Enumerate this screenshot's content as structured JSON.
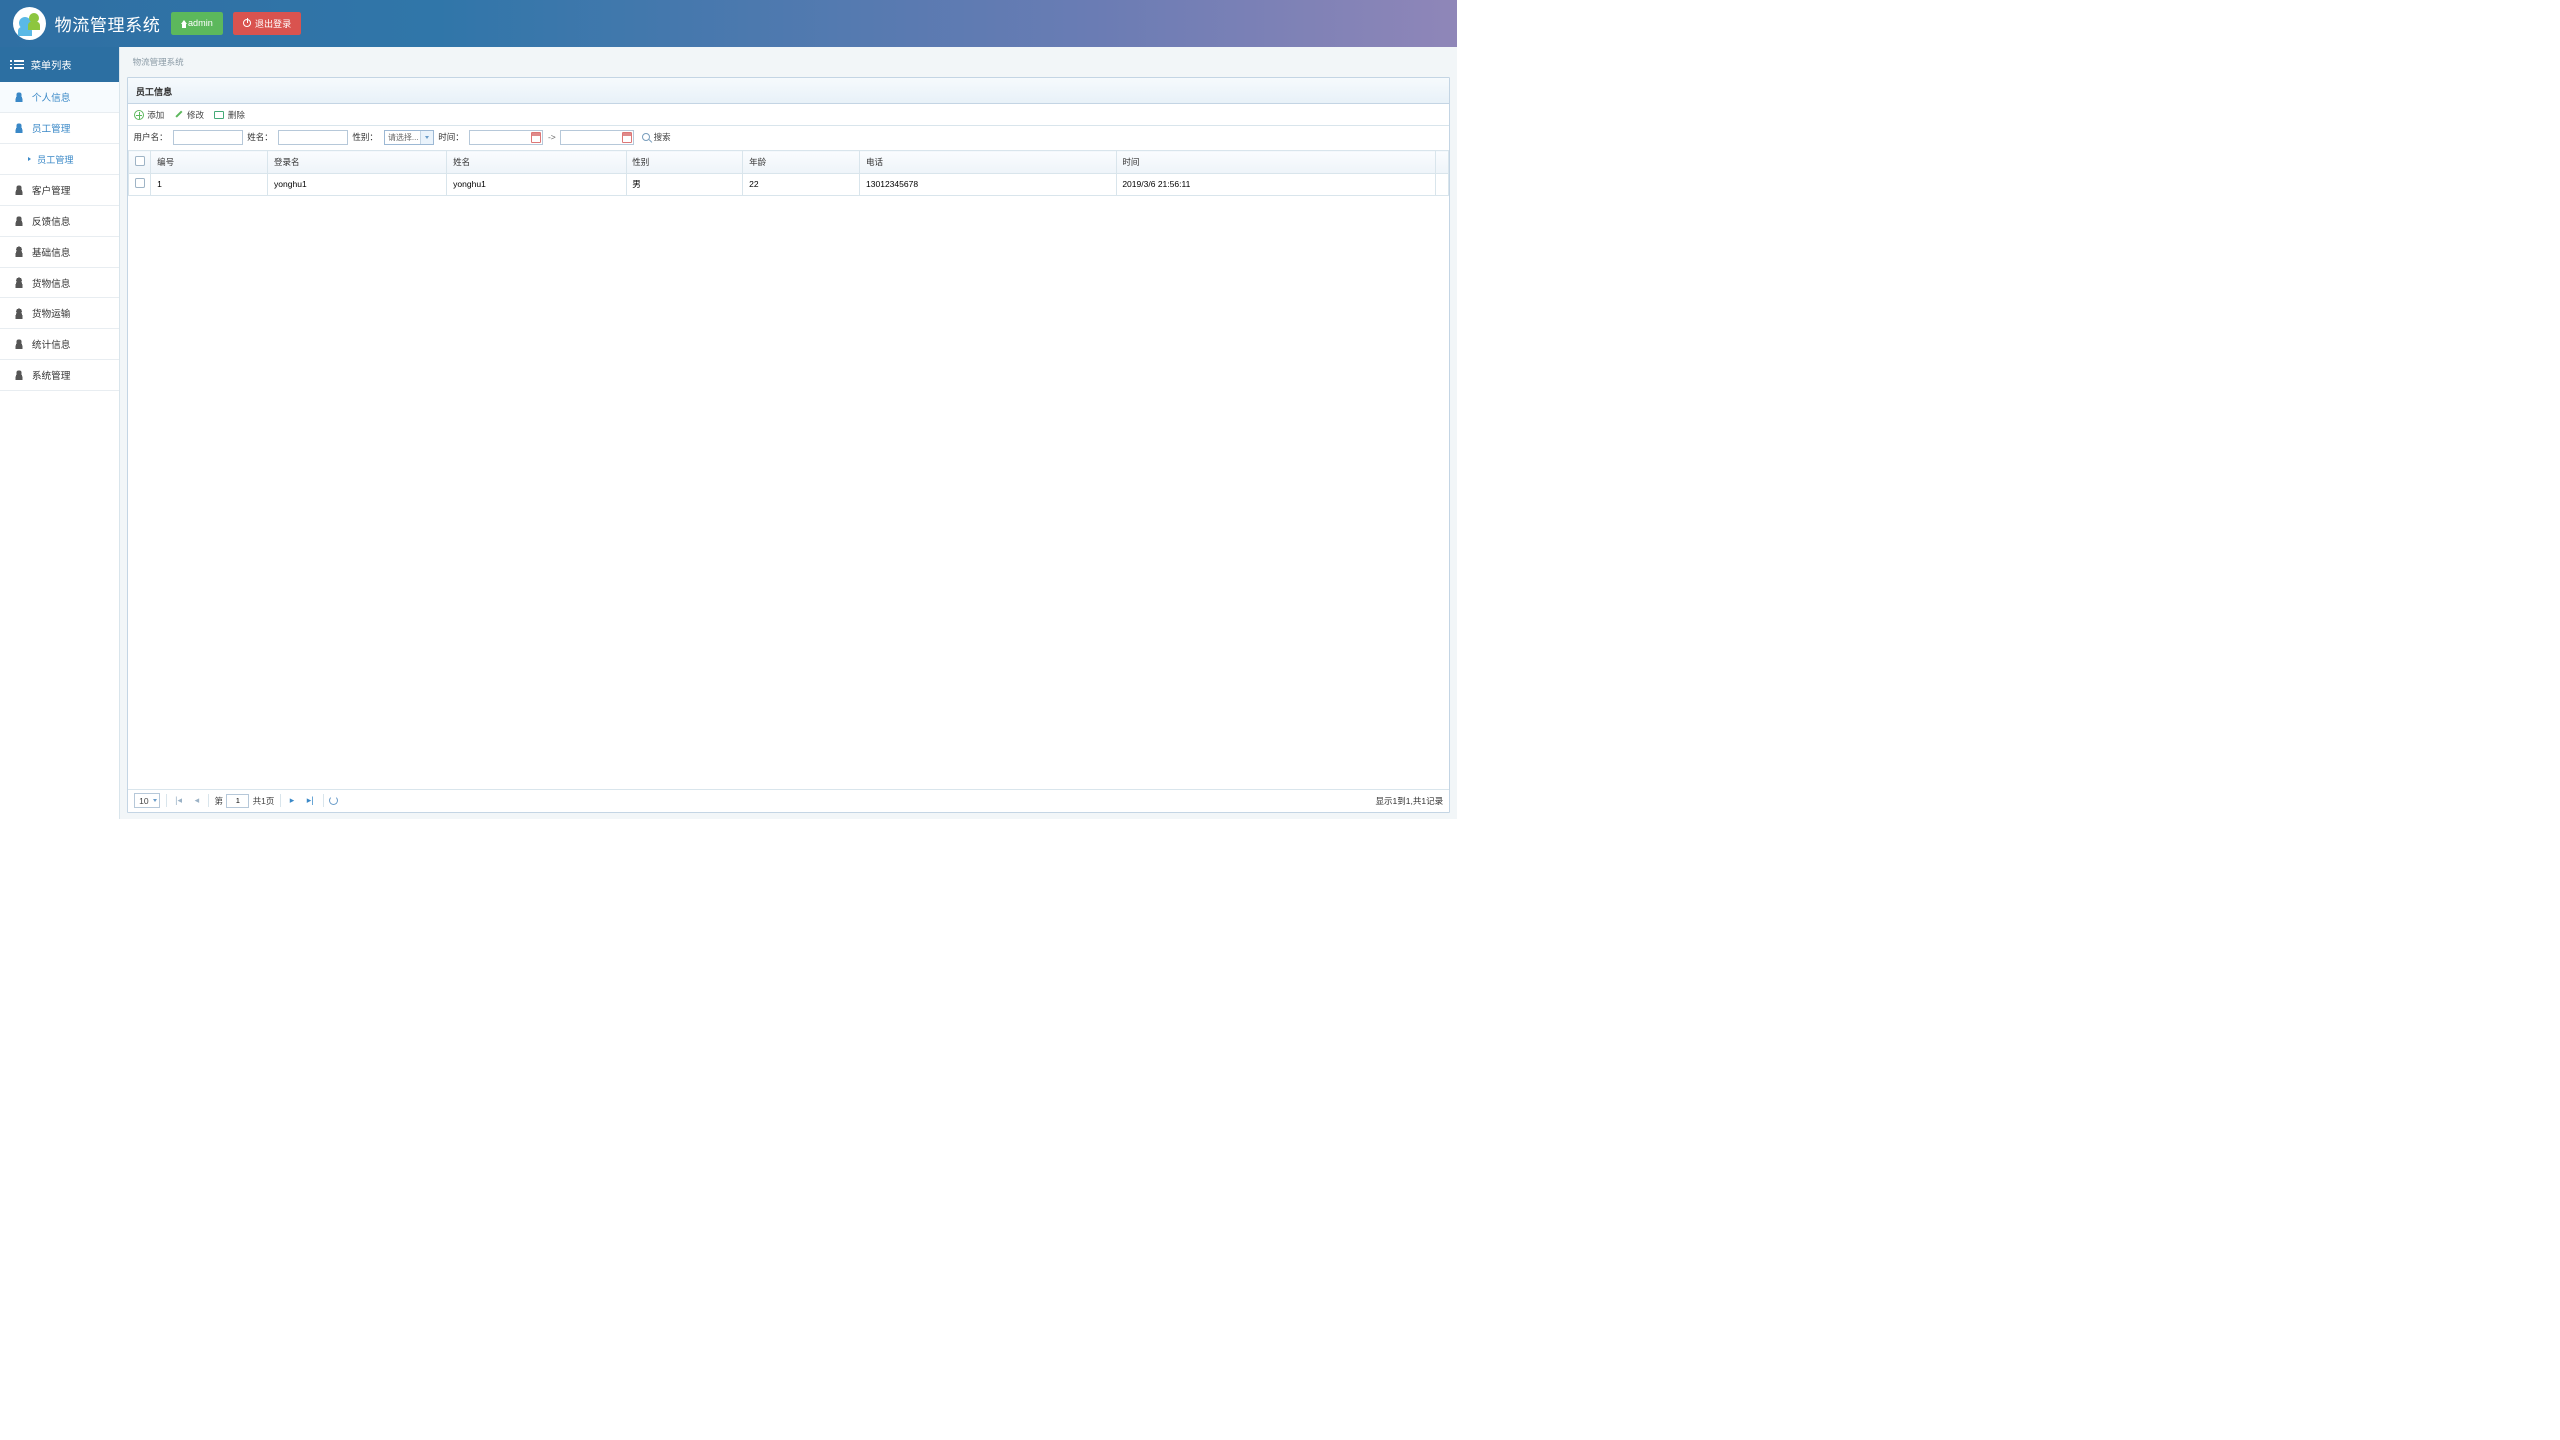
{
  "header": {
    "app_title": "物流管理系统",
    "admin_label": "admin",
    "logout_label": "退出登录"
  },
  "sidebar": {
    "header": "菜单列表",
    "items": [
      {
        "label": "个人信息",
        "active": true
      },
      {
        "label": "员工管理",
        "open": true
      },
      {
        "label": "客户管理"
      },
      {
        "label": "反馈信息"
      },
      {
        "label": "基础信息"
      },
      {
        "label": "货物信息"
      },
      {
        "label": "货物运输"
      },
      {
        "label": "统计信息"
      },
      {
        "label": "系统管理"
      }
    ],
    "sub_employee": "员工管理"
  },
  "breadcrumb": "物流管理系统",
  "panel": {
    "title": "员工信息",
    "toolbar": {
      "add": "添加",
      "edit": "修改",
      "delete": "删除"
    },
    "filters": {
      "username_label": "用户名：",
      "name_label": "姓名：",
      "gender_label": "性别：",
      "gender_placeholder": "请选择...",
      "time_label": "时间：",
      "range_sep": "->",
      "search_label": "搜索"
    },
    "columns": [
      "编号",
      "登录名",
      "姓名",
      "性别",
      "年龄",
      "电话",
      "时间"
    ],
    "rows": [
      {
        "id": "1",
        "login": "yonghu1",
        "name": "yonghu1",
        "gender": "男",
        "age": "22",
        "phone": "13012345678",
        "time": "2019/3/6 21:56:11"
      }
    ]
  },
  "pager": {
    "page_size": "10",
    "prefix": "第",
    "page": "1",
    "total_pages": "共1页",
    "summary": "显示1到1,共1记录"
  }
}
